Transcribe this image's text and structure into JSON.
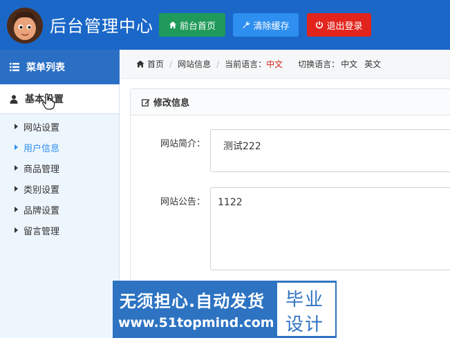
{
  "header": {
    "title": "后台管理中心",
    "buttons": {
      "home": "前台首页",
      "clear_cache": "清除缓存",
      "logout": "退出登录"
    }
  },
  "sidebar": {
    "menu_title": "菜单列表",
    "group_title": "基本设置",
    "items": [
      {
        "label": "网站设置"
      },
      {
        "label": "用户信息"
      },
      {
        "label": "商品管理"
      },
      {
        "label": "类别设置"
      },
      {
        "label": "品牌设置"
      },
      {
        "label": "留言管理"
      }
    ],
    "active_index": 1
  },
  "breadcrumb": {
    "home": "首页",
    "current_page": "网站信息",
    "current_lang_label": "当前语言：",
    "current_lang_value": "中文",
    "switch_lang_label": "切换语言：",
    "lang_options": [
      "中文",
      "英文"
    ]
  },
  "panel": {
    "title": "修改信息",
    "fields": [
      {
        "label": "网站简介：",
        "value": "测试222"
      },
      {
        "label": "网站公告：",
        "value": "1122"
      }
    ]
  },
  "watermark": {
    "line1": "无须担心.自动发货",
    "line2": "www.51topmind.com",
    "badge_line1": "毕业",
    "badge_line2": "设计"
  },
  "colors": {
    "header_bg": "#1a67c8",
    "btn_home": "#1f9a5a",
    "btn_clear": "#2e8ff0",
    "btn_logout": "#e2241c",
    "sidebar_title_bg": "#2a6fc4",
    "active_link": "#2e8ff0",
    "lang_red": "#d0281b"
  }
}
